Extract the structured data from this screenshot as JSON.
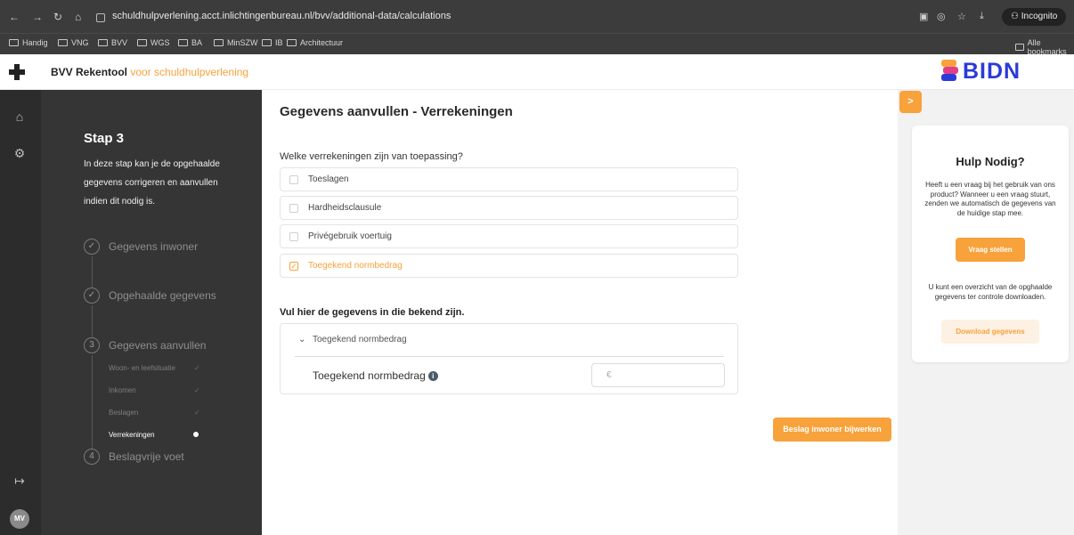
{
  "browser": {
    "url": "schuldhulpverlening.acct.inlichtingenbureau.nl/bvv/additional-data/calculations",
    "incognito_label": "Incognito",
    "bookmarks": [
      "Handig",
      "VNG",
      "BVV",
      "WGS",
      "BA",
      "MinSZW",
      "IB",
      "Architectuur"
    ],
    "all_bookmarks": "Alle bookmarks"
  },
  "header": {
    "title": "BVV Rekentool",
    "subtitle": "voor schuldhulpverlening",
    "brand": "BIDN"
  },
  "user": {
    "initials": "MV"
  },
  "stepper": {
    "title": "Stap 3",
    "description": "In deze stap kan je de opgehaalde gegevens corrigeren en aanvullen indien dit nodig is.",
    "steps": [
      {
        "marker": "✓",
        "label": "Gegevens inwoner"
      },
      {
        "marker": "✓",
        "label": "Opgehaalde gegevens"
      },
      {
        "marker": "3",
        "label": "Gegevens aanvullen"
      },
      {
        "marker": "4",
        "label": "Beslagvrije voet"
      }
    ],
    "substeps": [
      {
        "label": "Woon- en leefsituatie"
      },
      {
        "label": "Inkomen"
      },
      {
        "label": "Beslagen"
      },
      {
        "label": "Verrekeningen"
      }
    ]
  },
  "main": {
    "title": "Gegevens aanvullen - Verrekeningen",
    "question": "Welke verrekeningen zijn van toepassing?",
    "options": [
      {
        "label": "Toeslagen",
        "checked": false
      },
      {
        "label": "Hardheidsclausule",
        "checked": false
      },
      {
        "label": "Privégebruik voertuig",
        "checked": false
      },
      {
        "label": "Toegekend normbedrag",
        "checked": true
      }
    ],
    "section_title": "Vul hier de gegevens in die bekend zijn.",
    "accordion": {
      "title": "Toegekend normbedrag",
      "field_label": "Toegekend normbedrag",
      "field_placeholder": "€"
    },
    "submit_label": "Beslag inwoner bijwerken"
  },
  "help": {
    "toggle": ">",
    "title": "Hulp Nodig?",
    "text": "Heeft u een vraag bij het gebruik van ons product? Wanneer u een vraag stuurt, zenden we automatisch de gegevens van de huidige stap mee.",
    "ask_button": "Vraag stellen",
    "text2": "U kunt een overzicht van de opghaalde gegevens ter controle downloaden.",
    "download_button": "Download gegevens"
  },
  "colors": {
    "accent": "#f7a23b",
    "brand": "#2b3bd7",
    "sidebar": "#353535",
    "rail": "#2c2c2c"
  }
}
